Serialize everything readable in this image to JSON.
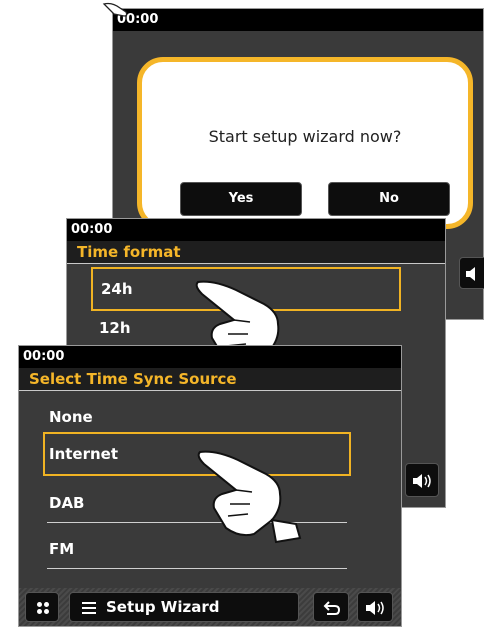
{
  "screen_wizard": {
    "clock": "00:00",
    "message": "Start setup wizard now?",
    "yes_label": "Yes",
    "no_label": "No"
  },
  "screen_time_format": {
    "clock": "00:00",
    "title": "Time format",
    "options": [
      "24h",
      "12h"
    ],
    "selected": "24h"
  },
  "screen_time_sync": {
    "clock": "00:00",
    "title": "Select Time Sync Source",
    "options": [
      "None",
      "Internet",
      "DAB",
      "FM"
    ],
    "selected": "Internet",
    "footer_label": "Setup Wizard"
  },
  "colors": {
    "accent": "#f5b629",
    "panel": "#3a3a3a",
    "bar": "#000000"
  },
  "icons": [
    "home-icon",
    "menu-icon",
    "back-icon",
    "volume-icon",
    "pointing-hand-icon"
  ]
}
